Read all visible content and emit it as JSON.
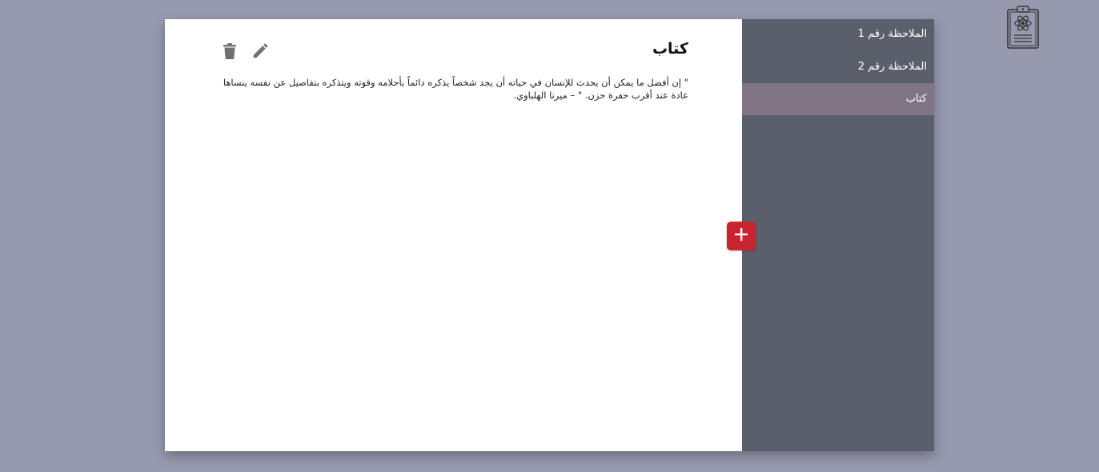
{
  "note": {
    "title": "كتاب",
    "body": "\" إن أفضل ما يمكن أن يحدث للإنسان في حياته أن يجد شخصاً يذكره دائماً بأحلامه وقوته ويتذكره بتفاصيل عن نفسه ينساها عادة عند أقرب حفرة حزن. \" – ميرنا الهلباوي."
  },
  "sidebar": {
    "items": [
      {
        "label": "الملاحظة رقم 1",
        "active": false
      },
      {
        "label": "الملاحظة رقم 2",
        "active": false
      },
      {
        "label": "كتاب",
        "active": true
      }
    ]
  },
  "icons": {
    "delete": "trash-icon",
    "edit": "pencil-icon",
    "add": "plus-icon",
    "logo": "clipboard-atom-icon"
  },
  "colors": {
    "background": "#9799af",
    "sidebar": "#5a5f6b",
    "sidebar_active": "#7f7584",
    "accent": "#c8232f"
  }
}
